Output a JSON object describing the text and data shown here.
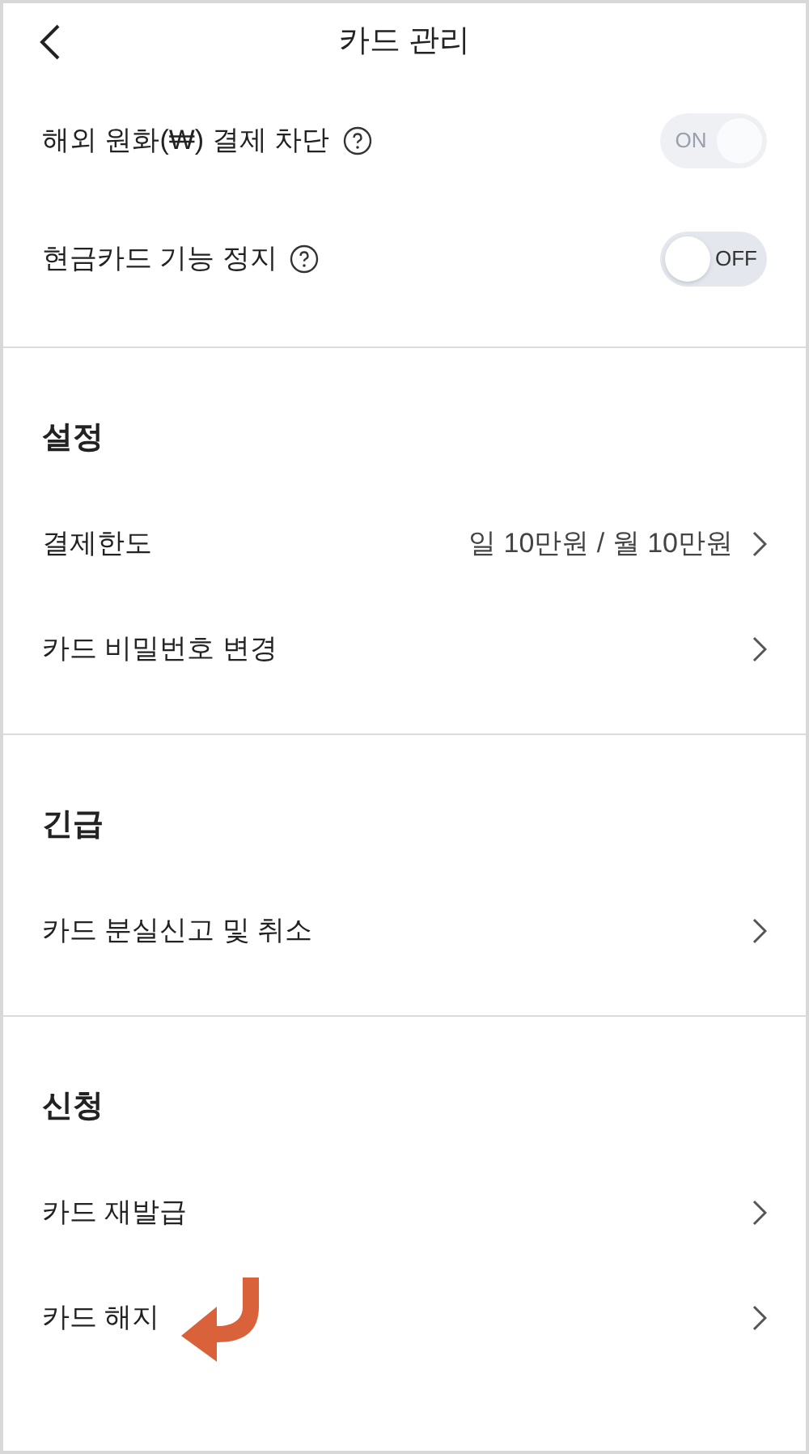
{
  "header": {
    "title": "카드 관리"
  },
  "toggles": [
    {
      "label": "해외 원화(₩) 결제 차단",
      "on": true,
      "disabled": true,
      "switch_text": "ON"
    },
    {
      "label": "현금카드 기능 정지",
      "on": false,
      "disabled": false,
      "switch_text": "OFF"
    }
  ],
  "sections": [
    {
      "title": "설정",
      "items": [
        {
          "label": "결제한도",
          "value": "일 10만원 / 월 10만원",
          "annotated": false
        },
        {
          "label": "카드 비밀번호 변경",
          "annotated": false
        }
      ]
    },
    {
      "title": "긴급",
      "items": [
        {
          "label": "카드 분실신고 및 취소",
          "annotated": false
        }
      ]
    },
    {
      "title": "신청",
      "items": [
        {
          "label": "카드 재발급",
          "annotated": false
        },
        {
          "label": "카드 해지",
          "annotated": true
        }
      ]
    }
  ]
}
